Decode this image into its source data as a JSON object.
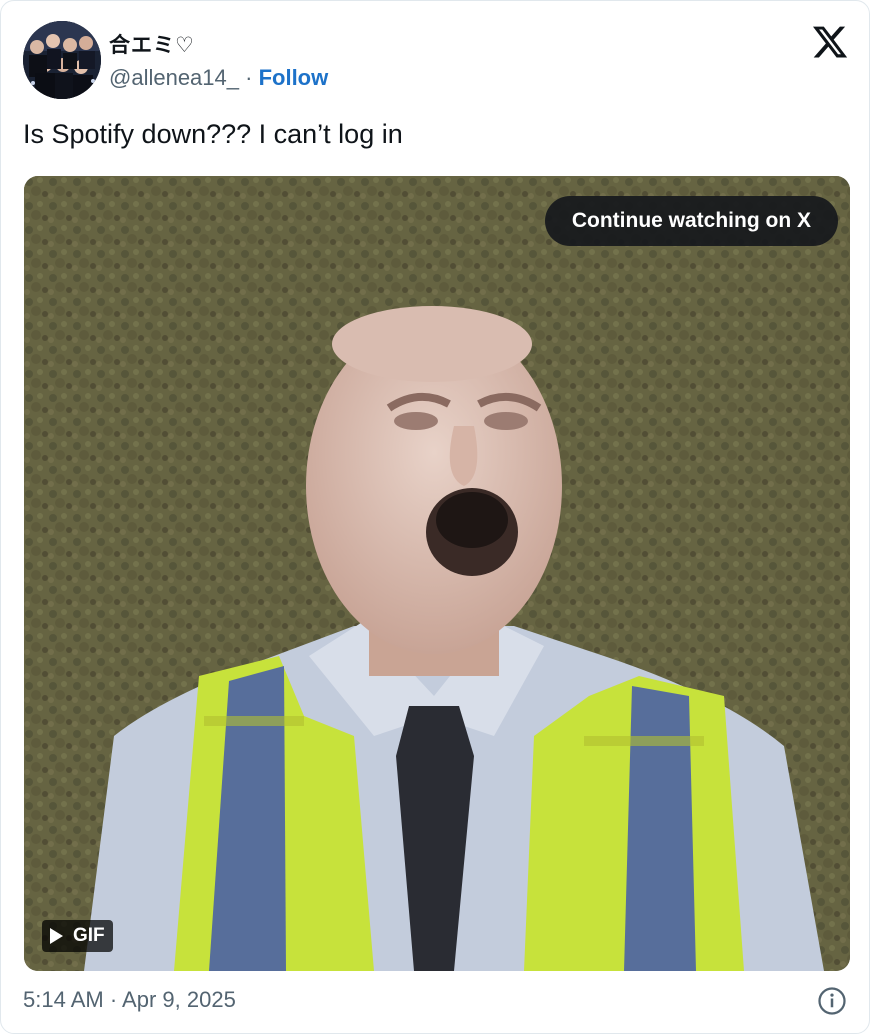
{
  "author": {
    "display_name": "合エミ♡",
    "handle": "@allenea14_",
    "separator": "·",
    "follow_label": "Follow",
    "avatar_icon": "group-photo-avatar"
  },
  "platform": {
    "logo_icon": "x-logo-icon"
  },
  "tweet": {
    "text": "Is Spotify down??? I can’t log in"
  },
  "media": {
    "continue_label": "Continue watching on X",
    "badge_label": "GIF",
    "badge_icon": "play-icon"
  },
  "footer": {
    "timestamp": "5:14 AM · Apr 9, 2025",
    "info_icon": "info-icon"
  },
  "colors": {
    "follow": "#1d72c9",
    "secondary_text": "#536471",
    "primary_text": "#0f1419",
    "border": "#e1e8ed"
  }
}
